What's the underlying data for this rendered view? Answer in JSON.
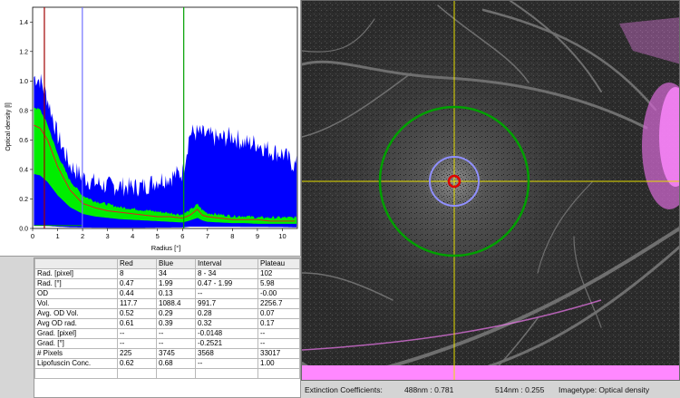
{
  "chart_data": {
    "type": "line",
    "ylabel": "Optical density [l]",
    "xlabel": "Radius [°]",
    "xlim": [
      0,
      10.6
    ],
    "ylim": [
      0,
      1.5
    ],
    "x_ticks": [
      "0",
      "1",
      "2",
      "3",
      "4",
      "5",
      "6",
      "7",
      "8",
      "9",
      "10"
    ],
    "y_ticks": [
      "0.0",
      "0.2",
      "0.4",
      "0.6",
      "0.8",
      "1.0",
      "1.2",
      "1.4"
    ],
    "markers": [
      {
        "name": "Red",
        "x": 0.47,
        "color": "#a00000"
      },
      {
        "name": "Blue",
        "x": 1.99,
        "color": "#7070ff"
      },
      {
        "name": "Green",
        "x": 6.05,
        "color": "#00a000"
      }
    ],
    "series": [
      {
        "color": "#0000ff",
        "x": [
          0.05,
          0.3,
          0.6,
          1,
          1.5,
          2,
          2.5,
          3,
          3.5,
          4,
          4.5,
          5,
          5.5,
          6,
          6.3,
          6.6,
          7,
          7.5,
          8,
          8.5,
          9,
          9.5,
          10,
          10.5
        ],
        "values": [
          1.0,
          0.98,
          0.85,
          0.6,
          0.4,
          0.32,
          0.28,
          0.26,
          0.26,
          0.25,
          0.26,
          0.3,
          0.32,
          0.35,
          0.62,
          0.62,
          0.6,
          0.58,
          0.6,
          0.55,
          0.55,
          0.5,
          0.48,
          0.4
        ]
      },
      {
        "color": "#00ee00",
        "x": [
          0.05,
          0.3,
          0.6,
          1,
          1.5,
          2,
          2.5,
          3,
          3.5,
          4,
          4.5,
          5,
          5.5,
          6,
          6.3,
          6.6,
          6.8,
          7,
          7.5,
          8,
          8.5,
          9,
          9.5,
          10,
          10.5
        ],
        "values": [
          0.82,
          0.8,
          0.7,
          0.5,
          0.32,
          0.22,
          0.18,
          0.16,
          0.14,
          0.13,
          0.12,
          0.11,
          0.1,
          0.09,
          0.12,
          0.16,
          0.12,
          0.1,
          0.09,
          0.08,
          0.08,
          0.07,
          0.07,
          0.07,
          0.07
        ]
      },
      {
        "color": "#e02020",
        "x": [
          0.05,
          0.3,
          0.6,
          1,
          1.5,
          2,
          2.5,
          3,
          3.5,
          4,
          4.5,
          5,
          5.5,
          6,
          6.3,
          6.6,
          6.8,
          7,
          7.5,
          8,
          8.5,
          9,
          9.5,
          10,
          10.5
        ],
        "values": [
          0.7,
          0.68,
          0.6,
          0.42,
          0.26,
          0.17,
          0.14,
          0.12,
          0.11,
          0.1,
          0.09,
          0.08,
          0.08,
          0.07,
          0.09,
          0.13,
          0.09,
          0.08,
          0.07,
          0.06,
          0.06,
          0.06,
          0.05,
          0.05,
          0.05
        ]
      }
    ]
  },
  "table": {
    "headers": [
      "",
      "Red",
      "Blue",
      "Interval",
      "Plateau"
    ],
    "rows": [
      [
        "Rad. [pixel]",
        "8",
        "34",
        "8 - 34",
        "102"
      ],
      [
        "Rad. [°]",
        "0.47",
        "1.99",
        "0.47 - 1.99",
        "5.98"
      ],
      [
        "OD",
        "0.44",
        "0.13",
        "--",
        "-0.00"
      ],
      [
        "Vol.",
        "117.7",
        "1088.4",
        "991.7",
        "2256.7"
      ],
      [
        "Avg. OD Vol.",
        "0.52",
        "0.29",
        "0.28",
        "0.07"
      ],
      [
        "Avg OD rad.",
        "0.61",
        "0.39",
        "0.32",
        "0.17"
      ],
      [
        "Grad. [pixel]",
        "--",
        "--",
        "-0.0148",
        "--"
      ],
      [
        "Grad. [°]",
        "--",
        "--",
        "-0.2521",
        "--"
      ],
      [
        "# Pixels",
        "225",
        "3745",
        "3568",
        "33017"
      ],
      [
        "Lipofuscin Conc.",
        "0.62",
        "0.68",
        "--",
        "1.00"
      ],
      [
        "",
        "",
        "",
        "",
        ""
      ]
    ]
  },
  "status": {
    "extinction_label": "Extinction Coefficients:",
    "ec_488": "488nm : 0.781",
    "ec_514": "514nm : 0.255",
    "imagetype": "Imagetype: Optical density"
  },
  "colors": {
    "red_marker": "#a00000",
    "blue_marker": "#8080ff",
    "green_marker": "#00a000",
    "crosshair": "#e8e000",
    "overlay_pink": "#ff80ff"
  }
}
